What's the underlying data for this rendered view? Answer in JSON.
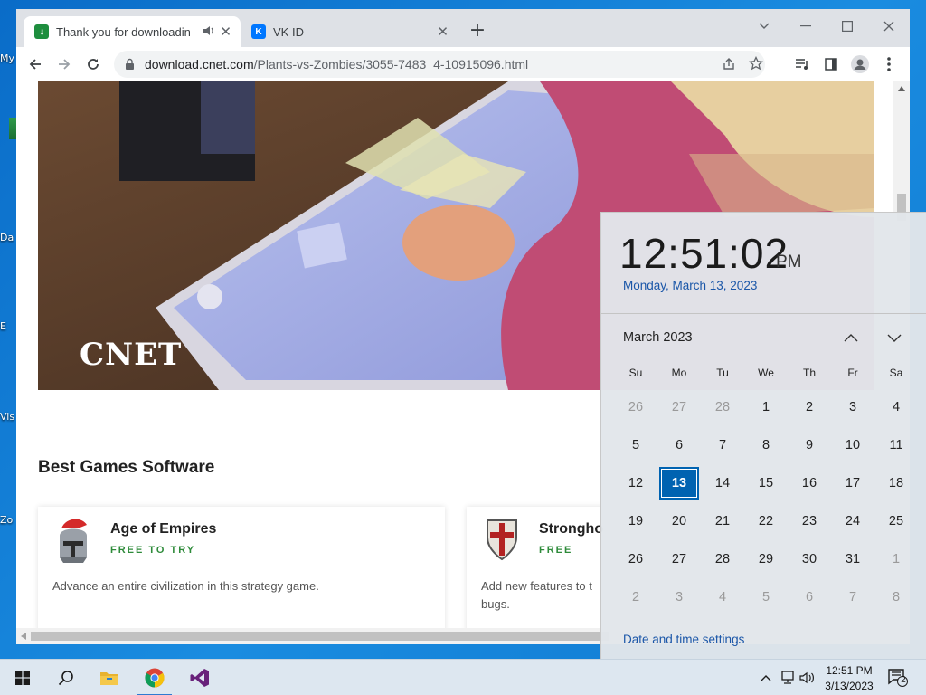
{
  "desktop": {
    "icons": [
      {
        "label": "My"
      },
      {
        "label": "Da"
      },
      {
        "label": "E"
      },
      {
        "label": "Vis"
      },
      {
        "label": "Zo"
      }
    ]
  },
  "browser": {
    "tabs": [
      {
        "title": "Thank you for downloading",
        "favicon": "cnet-download-icon",
        "favicon_color": "#1e8e3e",
        "active": true,
        "audio": true
      },
      {
        "title": "VK ID",
        "favicon": "vk-icon",
        "favicon_color": "#0077ff",
        "active": false,
        "audio": false
      }
    ],
    "new_tab_label": "+",
    "url_host": "download.cnet.com",
    "url_path": "/Plants-vs-Zombies/3055-7483_4-10915096.html"
  },
  "page": {
    "video_watermark": "CNET",
    "section_title": "Best Games Software",
    "cards": [
      {
        "name": "Age of Empires",
        "license": "FREE TO TRY",
        "description": "Advance an entire civilization in this strategy game.",
        "icon": "helmet-icon"
      },
      {
        "name": "Strongho",
        "license": "FREE",
        "description": "Add new features to t bugs.",
        "icon": "shield-cross-icon"
      }
    ]
  },
  "clock": {
    "time": "12:51:02",
    "ampm": "PM",
    "long_date": "Monday, March 13, 2023",
    "month_label": "March 2023",
    "weekdays": [
      "Su",
      "Mo",
      "Tu",
      "We",
      "Th",
      "Fr",
      "Sa"
    ],
    "weeks": [
      [
        "26",
        "27",
        "28",
        "1",
        "2",
        "3",
        "4"
      ],
      [
        "5",
        "6",
        "7",
        "8",
        "9",
        "10",
        "11"
      ],
      [
        "12",
        "13",
        "14",
        "15",
        "16",
        "17",
        "18"
      ],
      [
        "19",
        "20",
        "21",
        "22",
        "23",
        "24",
        "25"
      ],
      [
        "26",
        "27",
        "28",
        "29",
        "30",
        "31",
        "1"
      ],
      [
        "2",
        "3",
        "4",
        "5",
        "6",
        "7",
        "8"
      ]
    ],
    "selected_day": "13",
    "settings_link": "Date and time settings"
  },
  "taskbar": {
    "apps": [
      "start-icon",
      "search-icon",
      "file-explorer-icon",
      "chrome-icon",
      "visual-studio-icon"
    ],
    "tray_time": "12:51 PM",
    "tray_date": "3/13/2023",
    "notification_count": "2"
  },
  "colors": {
    "accent": "#0063b1",
    "link": "#1a56a8",
    "free_green": "#2e8b3a"
  }
}
